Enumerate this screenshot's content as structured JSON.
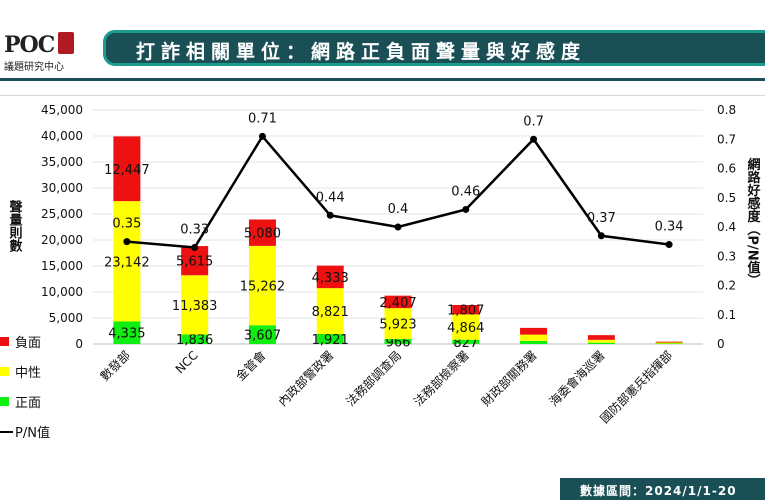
{
  "brand": {
    "logo_text": "POC",
    "subtitle": "議題研究中心"
  },
  "header": {
    "title": "打詐相關單位：網路正負面聲量與好感度"
  },
  "footer": {
    "text": "數據區間：2024/1/1-20"
  },
  "colors": {
    "negative": "#ee1111",
    "neutral": "#ffff00",
    "positive": "#11ee11",
    "line": "#000000",
    "header_bg": "#1a4f56",
    "header_border": "#1a9c8f"
  },
  "legend": [
    {
      "label": "負面",
      "type": "box",
      "color": "#ee1111"
    },
    {
      "label": "中性",
      "type": "box",
      "color": "#ffff00"
    },
    {
      "label": "正面",
      "type": "box",
      "color": "#11ee11"
    },
    {
      "label": "P/N值",
      "type": "line",
      "color": "#000000"
    }
  ],
  "chart_data": {
    "type": "bar",
    "stacked": true,
    "categories": [
      "數發部",
      "NCC",
      "金管會",
      "內政部警政署",
      "法務部調查局",
      "法務部檢察署",
      "財政部關務署",
      "海委會海巡署",
      "國防部憲兵指揮部"
    ],
    "series": [
      {
        "name": "正面",
        "values": [
          4335,
          1836,
          3607,
          1921,
          966,
          827,
          600,
          250,
          100
        ],
        "labels": [
          "4,335",
          "1,836",
          "3,607",
          "1,921",
          "966",
          "827",
          "",
          "",
          ""
        ]
      },
      {
        "name": "中性",
        "values": [
          23142,
          11383,
          15262,
          8821,
          5923,
          4864,
          1200,
          550,
          180
        ],
        "labels": [
          "23,142",
          "11,383",
          "15,262",
          "8,821",
          "5,923",
          "4,864",
          "",
          "",
          ""
        ]
      },
      {
        "name": "負面",
        "values": [
          12447,
          5615,
          5080,
          4333,
          2407,
          1807,
          1300,
          900,
          170
        ],
        "labels": [
          "12,447",
          "5,615",
          "5,080",
          "4,333",
          "2,407",
          "1,807",
          "",
          "",
          ""
        ]
      }
    ],
    "line_series": {
      "name": "P/N值",
      "values": [
        0.35,
        0.33,
        0.71,
        0.44,
        0.4,
        0.46,
        0.7,
        0.37,
        0.34
      ],
      "labels": [
        "0.35",
        "0.33",
        "0.71",
        "0.44",
        "0.4",
        "0.46",
        "0.7",
        "0.37",
        "0.34"
      ]
    },
    "ylabel": "聲量則數",
    "y2label": "網路好感度（P/N值）",
    "ylim": [
      0,
      45000
    ],
    "yticks": [
      "0",
      "5,000",
      "10,000",
      "15,000",
      "20,000",
      "25,000",
      "30,000",
      "35,000",
      "40,000",
      "45,000"
    ],
    "y2lim": [
      0,
      0.8
    ],
    "y2ticks": [
      "0",
      "0.1",
      "0.2",
      "0.3",
      "0.4",
      "0.5",
      "0.6",
      "0.7",
      "0.8"
    ],
    "legend_position": "left"
  }
}
